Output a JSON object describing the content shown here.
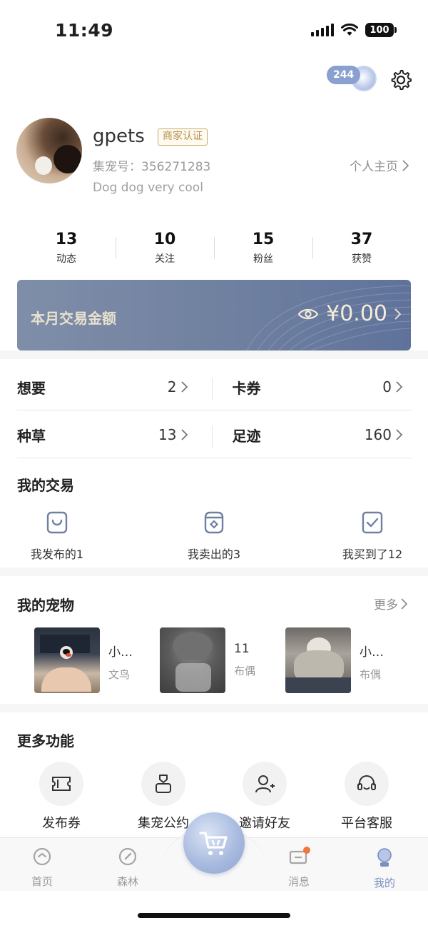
{
  "status_bar": {
    "time": "11:49",
    "battery": "100"
  },
  "header": {
    "coin_count": "244"
  },
  "profile": {
    "username": "gpets",
    "merchant_badge": "商家认证",
    "user_id": "集宠号：356271283",
    "homepage_link": "个人主页",
    "bio": "Dog dog very cool"
  },
  "stats": [
    {
      "value": "13",
      "label": "动态"
    },
    {
      "value": "10",
      "label": "关注"
    },
    {
      "value": "15",
      "label": "粉丝"
    },
    {
      "value": "37",
      "label": "获赞"
    }
  ],
  "transaction_card": {
    "label": "本月交易金额",
    "amount": "¥0.00"
  },
  "quick_grid": [
    {
      "label": "想要",
      "value": "2"
    },
    {
      "label": "卡券",
      "value": "0"
    },
    {
      "label": "种草",
      "value": "13"
    },
    {
      "label": "足迹",
      "value": "160"
    }
  ],
  "my_trades": {
    "title": "我的交易",
    "items": [
      {
        "label": "我发布的1",
        "icon": "bag-icon"
      },
      {
        "label": "我卖出的3",
        "icon": "jar-icon"
      },
      {
        "label": "我买到了12",
        "icon": "check-box-icon"
      }
    ]
  },
  "my_pets": {
    "title": "我的宠物",
    "more": "更多",
    "items": [
      {
        "name": "小…",
        "kind": "文鸟"
      },
      {
        "name": "11",
        "kind": "布偶"
      },
      {
        "name": "小…",
        "kind": "布偶"
      }
    ]
  },
  "more_functions": {
    "title": "更多功能",
    "items": [
      {
        "label": "发布券",
        "icon": "ticket-icon"
      },
      {
        "label": "集宠公约",
        "icon": "agreement-icon"
      },
      {
        "label": "邀请好友",
        "icon": "invite-user-icon"
      },
      {
        "label": "平台客服",
        "icon": "headset-icon"
      }
    ]
  },
  "tab_bar": {
    "items": [
      {
        "label": "首页",
        "icon": "home-icon"
      },
      {
        "label": "森林",
        "icon": "compass-icon"
      },
      {
        "label": "消息",
        "icon": "message-icon"
      },
      {
        "label": "我的",
        "icon": "profile-icon"
      }
    ],
    "active": "我的"
  },
  "colors": {
    "accent": "#7a8fc0",
    "card": "#6f80a0",
    "gold": "#c6a86c",
    "badge_dot": "#f0763a"
  }
}
